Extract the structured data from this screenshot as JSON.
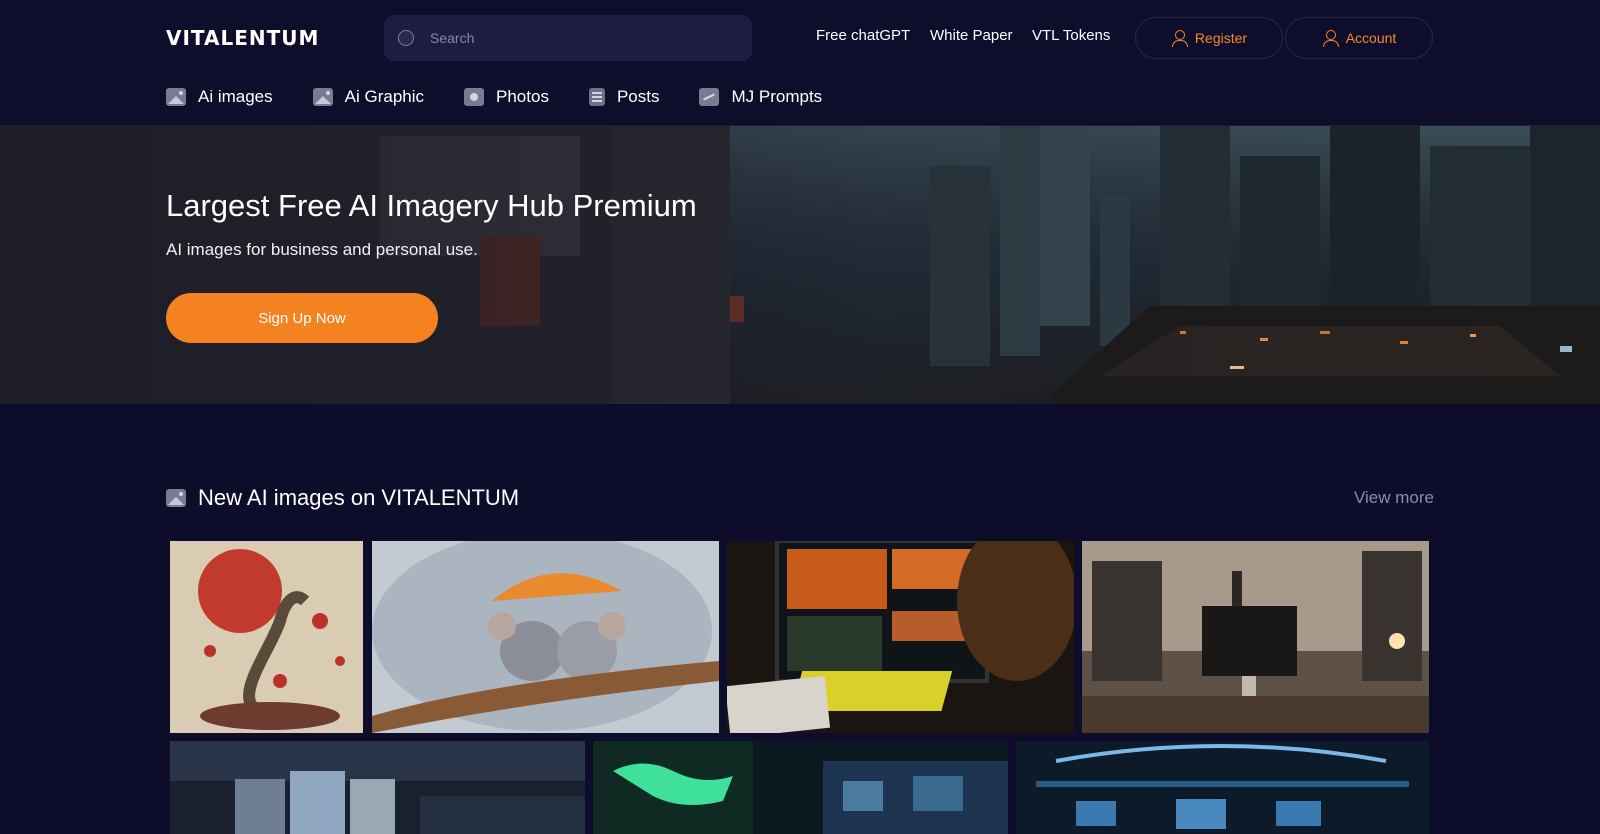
{
  "header": {
    "logo": "VITALENTUM",
    "search_placeholder": "Search",
    "links": [
      "Free chatGPT",
      "White Paper",
      "VTL Tokens"
    ],
    "register_label": "Register",
    "account_label": "Account"
  },
  "nav": {
    "items": [
      {
        "label": "Ai images",
        "icon": "image-icon"
      },
      {
        "label": "Ai Graphic",
        "icon": "image-icon"
      },
      {
        "label": "Photos",
        "icon": "photo-icon"
      },
      {
        "label": "Posts",
        "icon": "posts-icon"
      },
      {
        "label": "MJ Prompts",
        "icon": "prompts-icon"
      }
    ]
  },
  "hero": {
    "title": "Largest Free AI Imagery Hub Premium",
    "subtitle": "AI images for business and personal use.",
    "cta_label": "Sign Up Now"
  },
  "section": {
    "title": "New AI images on VITALENTUM",
    "view_more": "View more"
  },
  "colors": {
    "background": "#0d0c2a",
    "accent": "#f58220",
    "muted_text": "#8d8ca5"
  }
}
